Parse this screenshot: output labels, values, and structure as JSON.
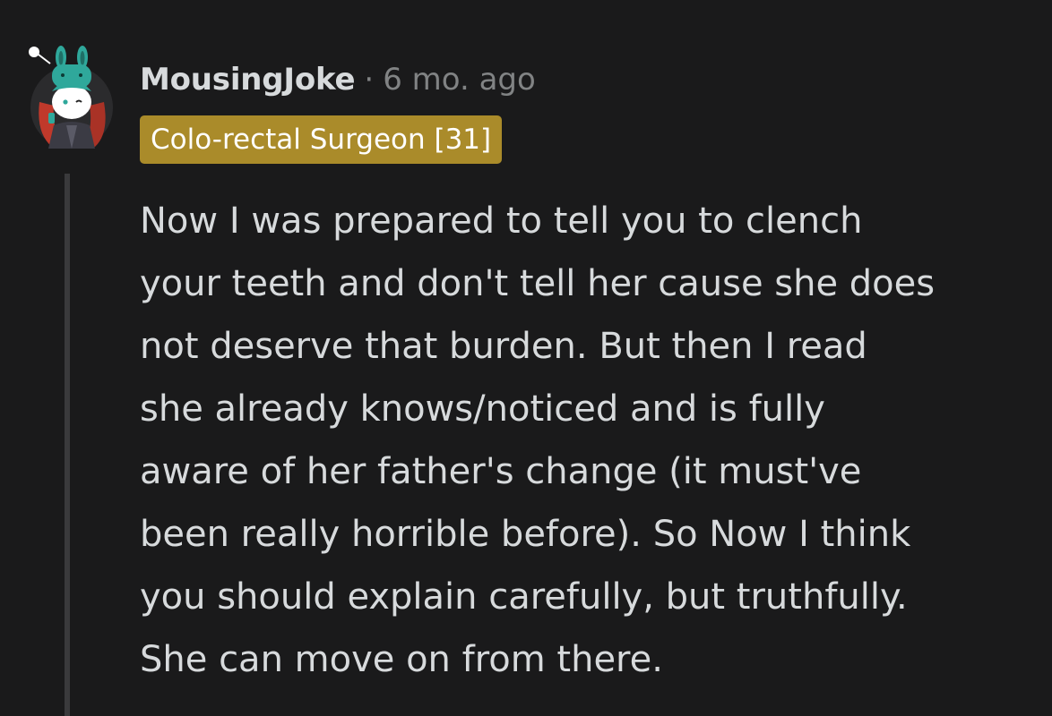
{
  "comment": {
    "author": "MousingJoke",
    "separator": "·",
    "timestamp": "6 mo. ago",
    "flair": "Colo-rectal Surgeon [31]",
    "flair_color": "#aa8b2a",
    "avatar_icon": "snoo-avatar-icon",
    "body_lines": [
      "Now I was prepared to tell you to clench",
      "your teeth and don't tell her cause she does",
      "not deserve that burden. But then I read",
      "she already knows/noticed and is fully",
      "aware of her father's change (it must've",
      "been really horrible before). So Now I think",
      "you should explain carefully, but truthfully.",
      "She can move on from there."
    ]
  },
  "colors": {
    "background": "#1a1a1b",
    "text": "#d7dadc",
    "muted": "#818384",
    "thread_line": "#3a3a3c"
  }
}
